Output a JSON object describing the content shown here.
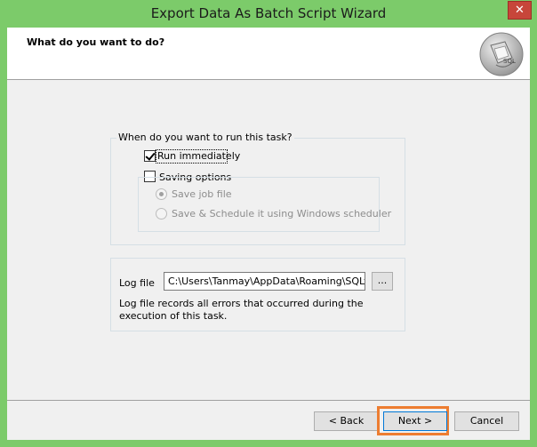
{
  "window": {
    "title": "Export Data As Batch Script Wizard",
    "close_glyph": "✕"
  },
  "header": {
    "title": "What do you want to do?",
    "logo_icon": "sql-wizard-icon",
    "logo_text": "SQL"
  },
  "run_group": {
    "legend": "When do you want to run this task?",
    "run_immediately": {
      "label": "Run immediately",
      "checked": true
    },
    "saving_options": {
      "label": "Saving options",
      "checked": false
    },
    "save_job_file": {
      "label": "Save job file",
      "selected": true,
      "enabled": false
    },
    "save_schedule": {
      "label": "Save & Schedule it using Windows scheduler",
      "selected": false,
      "enabled": false
    }
  },
  "log_group": {
    "label": "Log file",
    "value": "C:\\Users\\Tanmay\\AppData\\Roaming\\SQLyog\\",
    "browse_label": "...",
    "description": "Log file records all errors that occurred during the execution of this task."
  },
  "footer": {
    "back_label": "< Back",
    "next_label": "Next >",
    "cancel_label": "Cancel"
  },
  "colors": {
    "title_bar": "#7ccb6a",
    "close_button": "#c7463a",
    "highlight": "#ed7d31"
  }
}
